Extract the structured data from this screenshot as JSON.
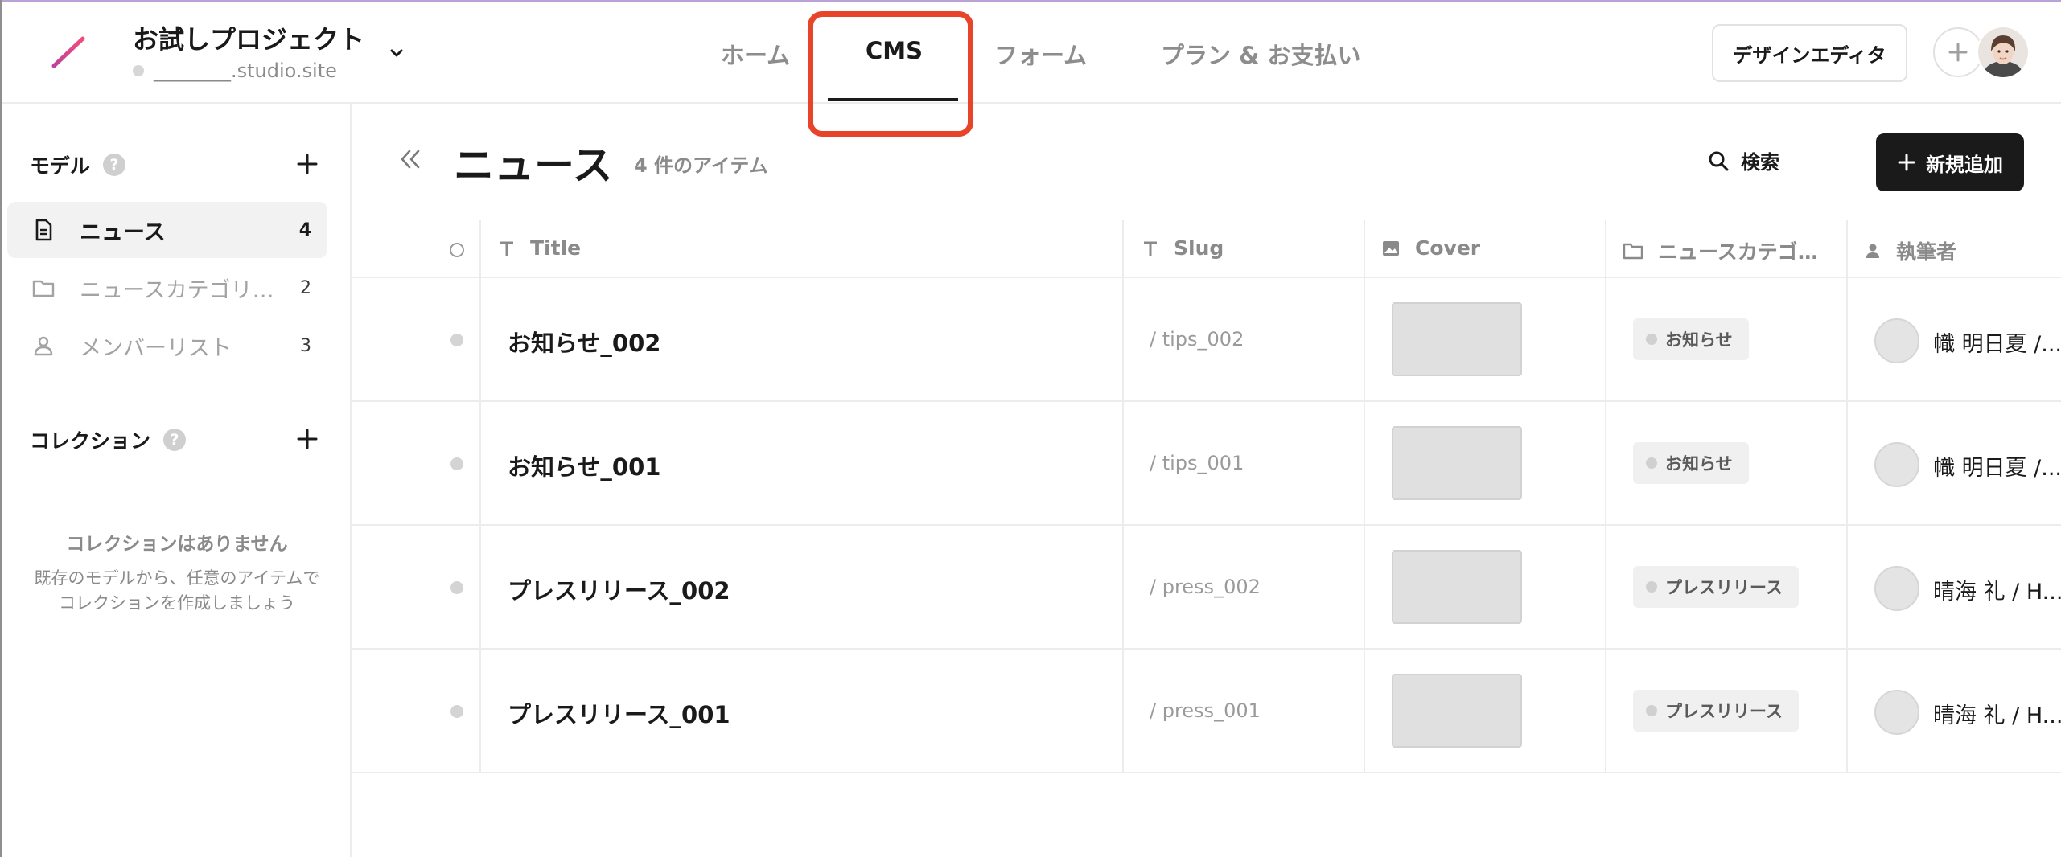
{
  "colors": {
    "accent_highlight": "#e8442a",
    "primary_button": "#1a1a1a",
    "logo_gradient_start": "#c0409c",
    "logo_gradient_end": "#f04d7a"
  },
  "header": {
    "project_name": "お試しプロジェクト",
    "project_domain": "________.studio.site",
    "nav_tabs": [
      {
        "label": "ホーム",
        "active": false
      },
      {
        "label": "CMS",
        "active": true
      },
      {
        "label": "フォーム",
        "active": false
      },
      {
        "label": "プラン & お支払い",
        "active": false
      }
    ],
    "design_editor_label": "デザインエディタ"
  },
  "sidebar": {
    "models_heading": "モデル",
    "help_mark": "?",
    "models": [
      {
        "label": "ニュース",
        "count": "4",
        "icon": "document-icon",
        "active": true
      },
      {
        "label": "ニュースカテゴリ…",
        "count": "2",
        "icon": "folder-icon",
        "active": false
      },
      {
        "label": "メンバーリスト",
        "count": "3",
        "icon": "person-icon",
        "active": false
      }
    ],
    "collections_heading": "コレクション",
    "empty_title": "コレクションはありません",
    "empty_desc_line1": "既存のモデルから、任意のアイテムで",
    "empty_desc_line2": "コレクションを作成しましょう"
  },
  "main": {
    "title": "ニュース",
    "item_count": "4 件のアイテム",
    "search_label": "検索",
    "add_label": "新規追加"
  },
  "table": {
    "columns": [
      {
        "label": "Title",
        "icon": "text-type-icon"
      },
      {
        "label": "Slug",
        "icon": "text-type-icon"
      },
      {
        "label": "Cover",
        "icon": "image-icon"
      },
      {
        "label": "ニュースカテゴ…",
        "icon": "folder-icon"
      },
      {
        "label": "執筆者",
        "icon": "person-icon"
      }
    ],
    "rows": [
      {
        "title": "お知らせ_002",
        "slug": "/ tips_002",
        "category": "お知らせ",
        "author": "幟 明日夏 /..."
      },
      {
        "title": "お知らせ_001",
        "slug": "/ tips_001",
        "category": "お知らせ",
        "author": "幟 明日夏 /..."
      },
      {
        "title": "プレスリリース_002",
        "slug": "/ press_002",
        "category": "プレスリリース",
        "author": "晴海 礼 / H..."
      },
      {
        "title": "プレスリリース_001",
        "slug": "/ press_001",
        "category": "プレスリリース",
        "author": "晴海 礼 / H..."
      }
    ]
  }
}
